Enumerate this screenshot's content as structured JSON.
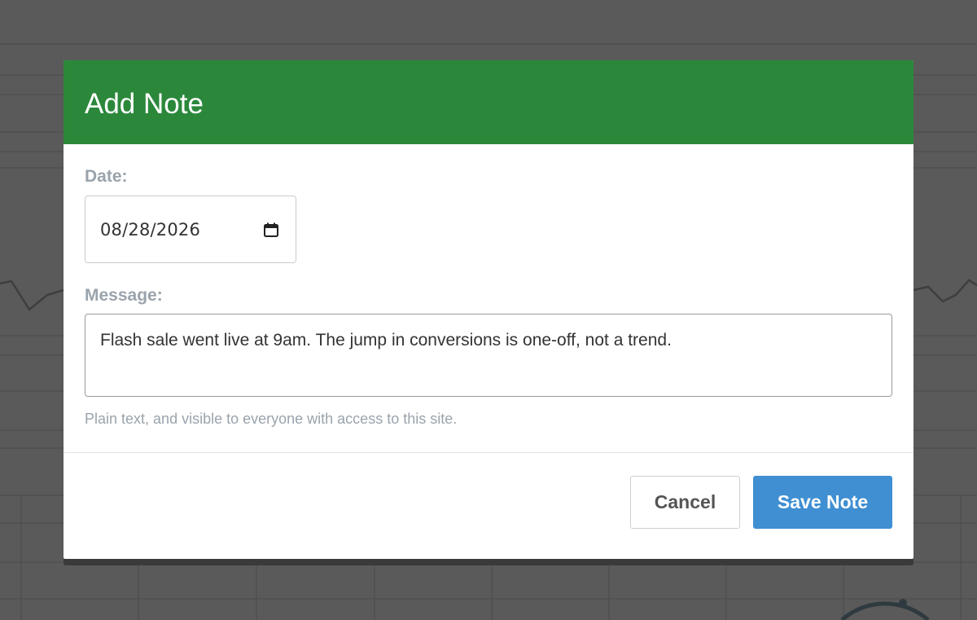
{
  "modal": {
    "title": "Add Note",
    "date_label": "Date:",
    "date_value": "08/28/2026",
    "calendar_icon": "calendar-icon",
    "message_label": "Message:",
    "message_value": "Flash sale went live at 9am. The jump in conversions is one-off, not a trend.",
    "help_text": "Plain text, and visible to everyone with access to this site.",
    "cancel_label": "Cancel",
    "save_label": "Save Note"
  },
  "colors": {
    "header": "#2b883b",
    "primary_button": "#3f8fd2",
    "overlay": "#5a5a5a"
  }
}
